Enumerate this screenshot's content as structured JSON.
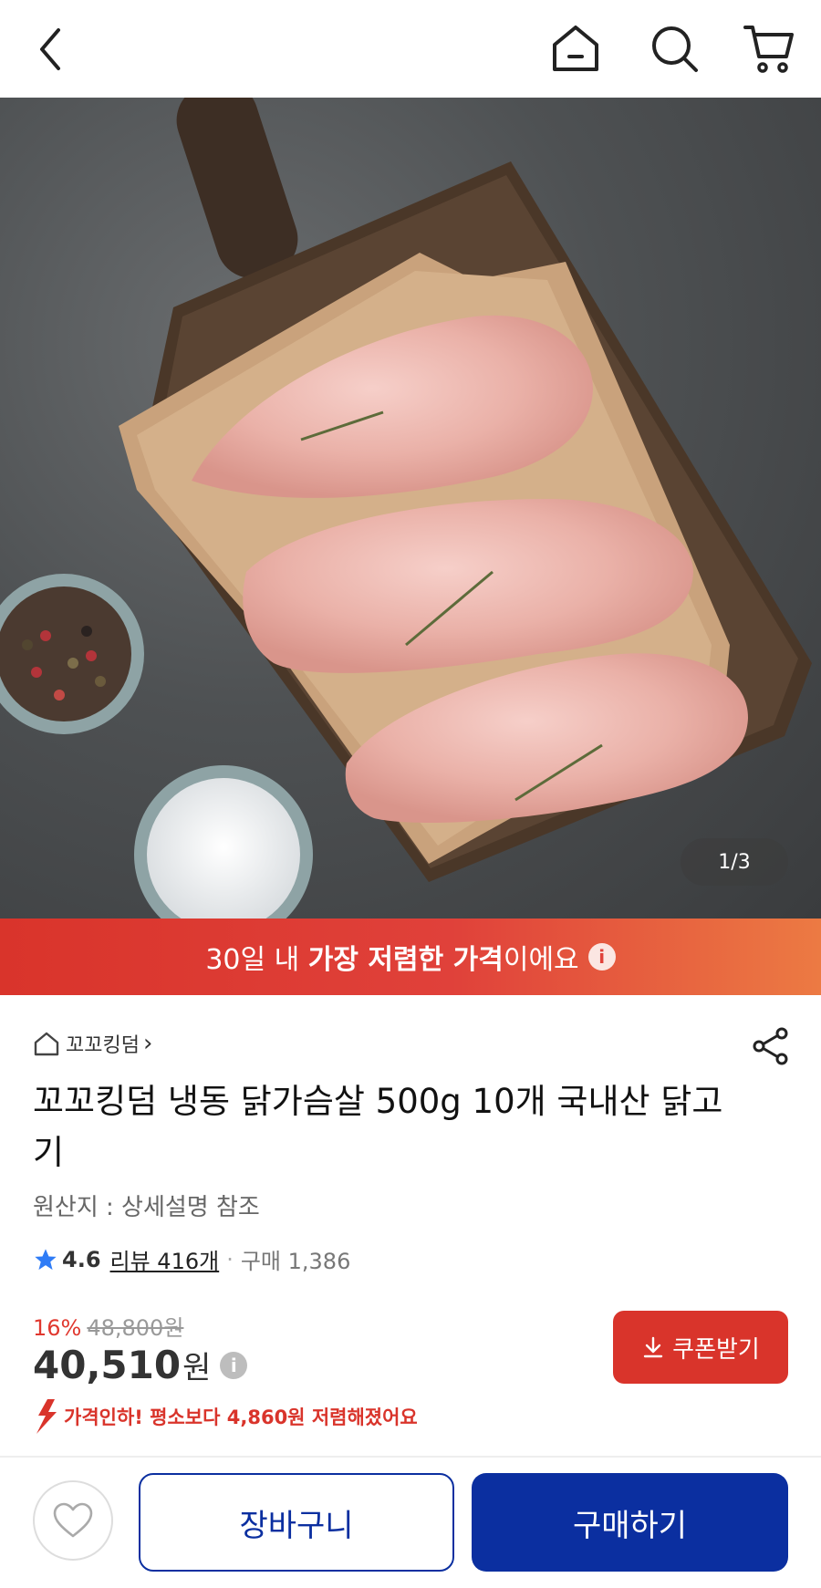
{
  "header": {
    "back_icon": "chevron-left-icon",
    "home_icon": "home-icon",
    "search_icon": "search-icon",
    "cart_icon": "cart-icon"
  },
  "gallery": {
    "counter": "1/3"
  },
  "banner": {
    "prefix": "30일 내 ",
    "emphasis": "가장 저렴한 가격",
    "suffix": "이에요",
    "info_glyph": "i"
  },
  "product": {
    "store_name": "꼬꼬킹덤",
    "store_chevron": "›",
    "title": "꼬꼬킹덤 냉동 닭가슴살 500g 10개 국내산 닭고기",
    "origin": "원산지 : 상세설명 참조",
    "rating": "4.6",
    "review_link": "리뷰 416개",
    "dot": "·",
    "purchases": "구매 1,386"
  },
  "pricing": {
    "discount_percent": "16%",
    "original_price": "48,800원",
    "price": "40,510",
    "price_unit": "원",
    "info_glyph": "i",
    "coupon_button": "쿠폰받기",
    "price_drop_note": "가격인하! 평소보다 4,860원 저렴해졌어요"
  },
  "actions": {
    "cart_button": "장바구니",
    "buy_button": "구매하기"
  },
  "colors": {
    "accent_red": "#d9342b",
    "primary_blue": "#0b2fa0",
    "star_blue": "#2f7cf6"
  }
}
